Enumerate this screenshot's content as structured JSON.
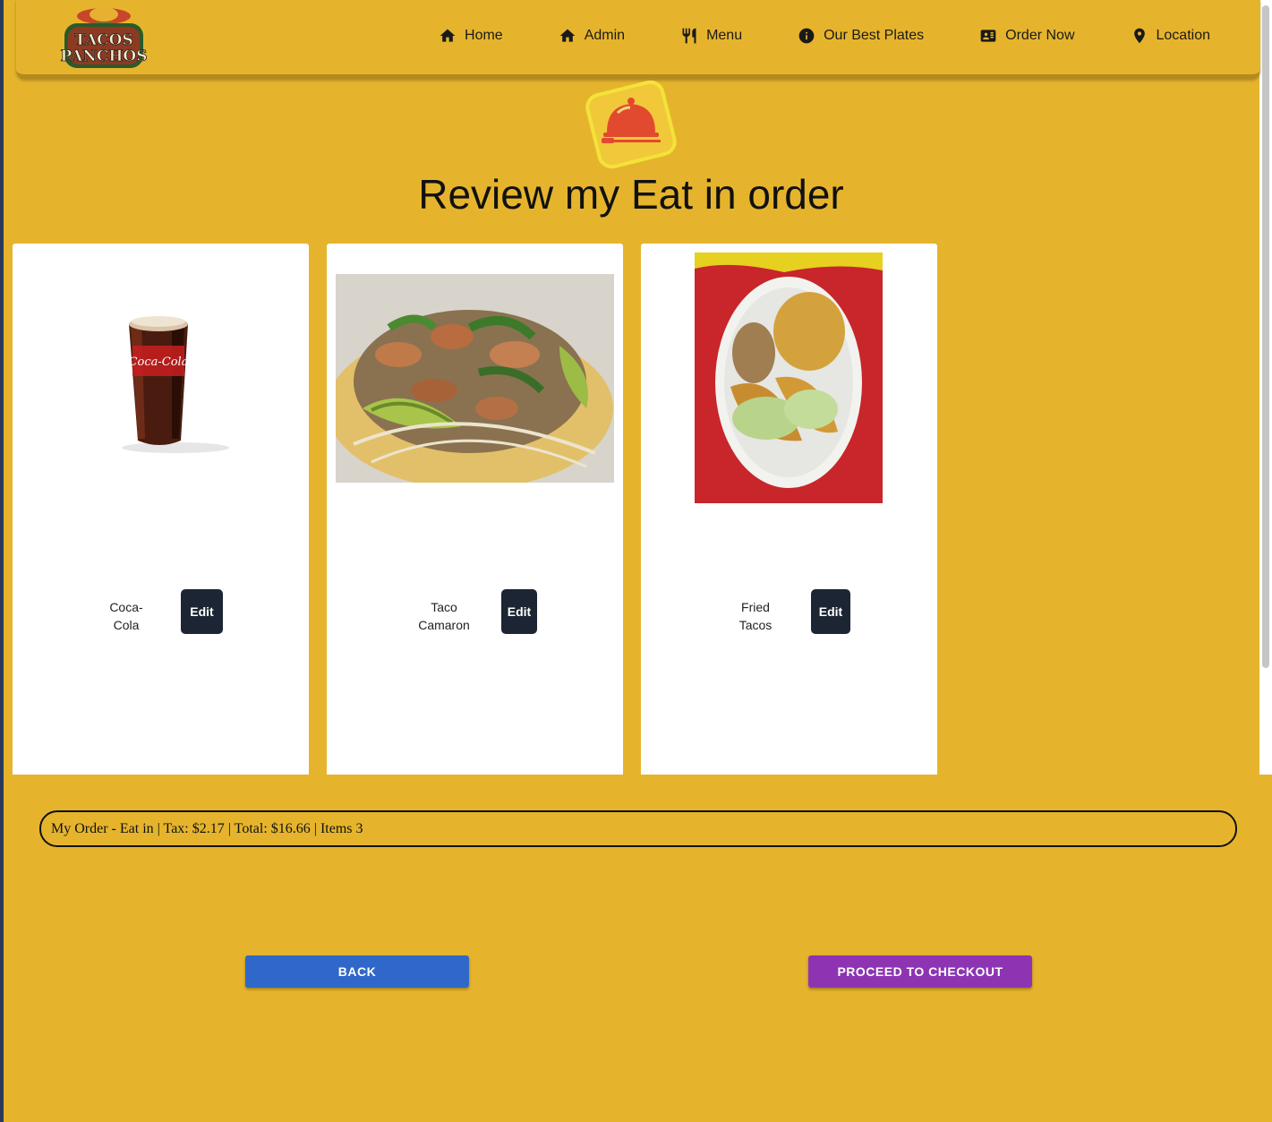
{
  "brand": {
    "logo_text_line1": "TACOS",
    "logo_text_line2": "PANCHOS"
  },
  "nav": {
    "items": [
      {
        "label": "Home",
        "icon": "home-icon"
      },
      {
        "label": "Admin",
        "icon": "home-icon"
      },
      {
        "label": "Menu",
        "icon": "utensils-icon"
      },
      {
        "label": "Our Best Plates",
        "icon": "info-icon"
      },
      {
        "label": "Order Now",
        "icon": "id-card-icon"
      },
      {
        "label": "Location",
        "icon": "map-pin-icon"
      }
    ]
  },
  "page": {
    "title": "Review my Eat in order",
    "header_icon": "serving-cloche-icon"
  },
  "items": [
    {
      "name_line1": "Coca-",
      "name_line2": "Cola",
      "edit_label": "Edit",
      "image": "coca-cola-glass"
    },
    {
      "name_line1": "Taco",
      "name_line2": "Camaron",
      "edit_label": "Edit",
      "image": "taco-camaron-photo"
    },
    {
      "name_line1": "Fried",
      "name_line2": "Tacos",
      "edit_label": "Edit",
      "image": "fried-tacos-plate-photo"
    }
  ],
  "summary": {
    "text": "My Order - Eat in | Tax: $2.17 | Total: $16.66 | Items 3"
  },
  "actions": {
    "back_label": "BACK",
    "checkout_label": "PROCEED TO CHECKOUT"
  },
  "colors": {
    "background": "#e6b42c",
    "back_button": "#2f68c8",
    "checkout_button": "#8e34b3",
    "edit_button": "#1c2533",
    "cloche": "#e24a30"
  }
}
